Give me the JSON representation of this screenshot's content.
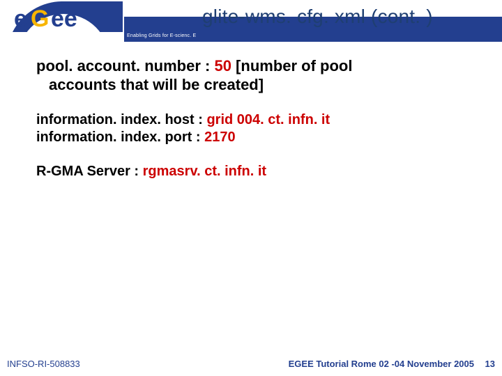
{
  "header": {
    "title": "glite-wms. cfg. xml (cont. )",
    "tagline": "Enabling Grids for E-scienc. E",
    "logo_text": "eGee"
  },
  "content": {
    "line1_key": "pool. account. number : ",
    "line1_val": "50",
    "line1_desc_a": " [number of pool",
    "line1_desc_b": "accounts that will be created]",
    "line2_key": "information. index. host : ",
    "line2_val": "grid 004. ct. infn. it",
    "line3_key": "information. index. port : ",
    "line3_val": "2170",
    "line4_key": "R-GMA Server : ",
    "line4_val": "rgmasrv. ct. infn. it"
  },
  "footer": {
    "left": "INFSO-RI-508833",
    "right": "EGEE Tutorial Rome 02 -04 November 2005",
    "page": "13"
  }
}
